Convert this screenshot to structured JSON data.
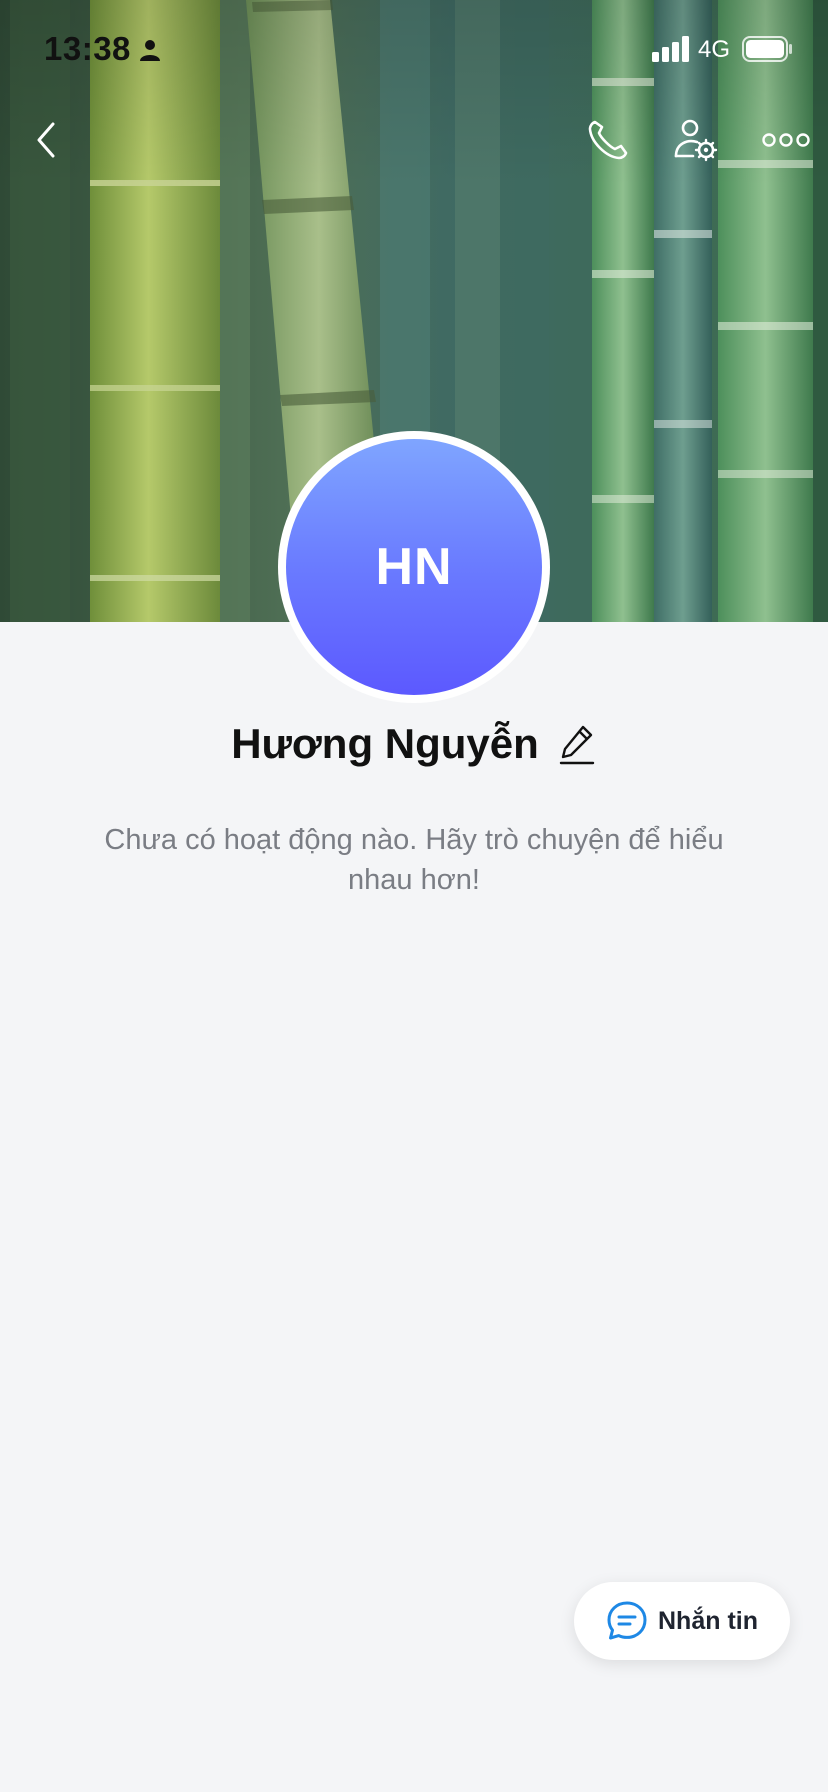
{
  "status_bar": {
    "time": "13:38",
    "network": "4G",
    "icons": [
      "person-icon",
      "signal-icon",
      "battery-icon"
    ]
  },
  "header": {
    "icons": [
      "back-icon",
      "phone-icon",
      "user-settings-icon",
      "more-icon"
    ]
  },
  "profile": {
    "initials": "HN",
    "name": "Hương Nguyễn",
    "edit_icon": "pencil-icon"
  },
  "feed": {
    "empty_message": "Chưa có hoạt động nào. Hãy trò chuyện để hiểu nhau hơn!"
  },
  "message_button": {
    "label": "Nhắn tin",
    "icon": "chat-bubble-icon"
  },
  "colors": {
    "background": "#f4f5f7",
    "avatar_top": "#7fa5ff",
    "avatar_bottom": "#5c59ff",
    "accent": "#1e88e5",
    "text_primary": "#111111",
    "text_secondary": "#7a7d84"
  }
}
